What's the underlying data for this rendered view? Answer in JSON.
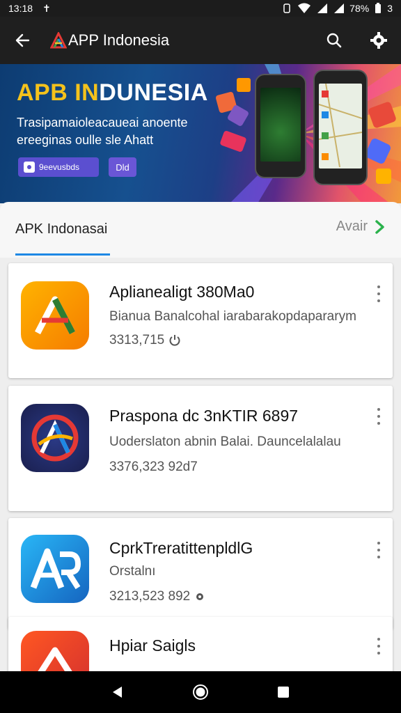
{
  "status_bar": {
    "time": "13:18",
    "battery": "78%",
    "extra": "3"
  },
  "app_bar": {
    "title": "APP Indonesia",
    "back_icon": "arrow-back-icon",
    "search_icon": "search-icon",
    "settings_icon": "gear-icon"
  },
  "banner": {
    "title_part1": "APB IN",
    "title_part2": "DUNESIA",
    "subtitle": "Trasipamaioleacaueai anoente ereeginas oulle sle Ahatt",
    "button1": "9eevusbds",
    "button2": "Dld"
  },
  "section": {
    "title": "APK Indonasai",
    "link": "Avair"
  },
  "apps": [
    {
      "name": "Aplianealigt 380Ma0",
      "desc": "Bianua Banalcohal iarabarakopdapararym",
      "meta": "3313,715"
    },
    {
      "name": "Praspona dc 3nKTIR 6897",
      "desc": "Uoderslaton abnin Balai. Dauncelalalau",
      "meta": "3376,323 92d7"
    },
    {
      "name": "CprkTreratittenpldlG",
      "desc": "Orstalnı",
      "meta": "3213,523 892"
    },
    {
      "name": "Hpiar Saigls",
      "desc": "",
      "meta": ""
    }
  ],
  "colors": {
    "accent": "#1e88e5",
    "link_chevron": "#2bb24c",
    "title_yellow": "#f4c21c",
    "app_bar": "#1f1f1f"
  }
}
